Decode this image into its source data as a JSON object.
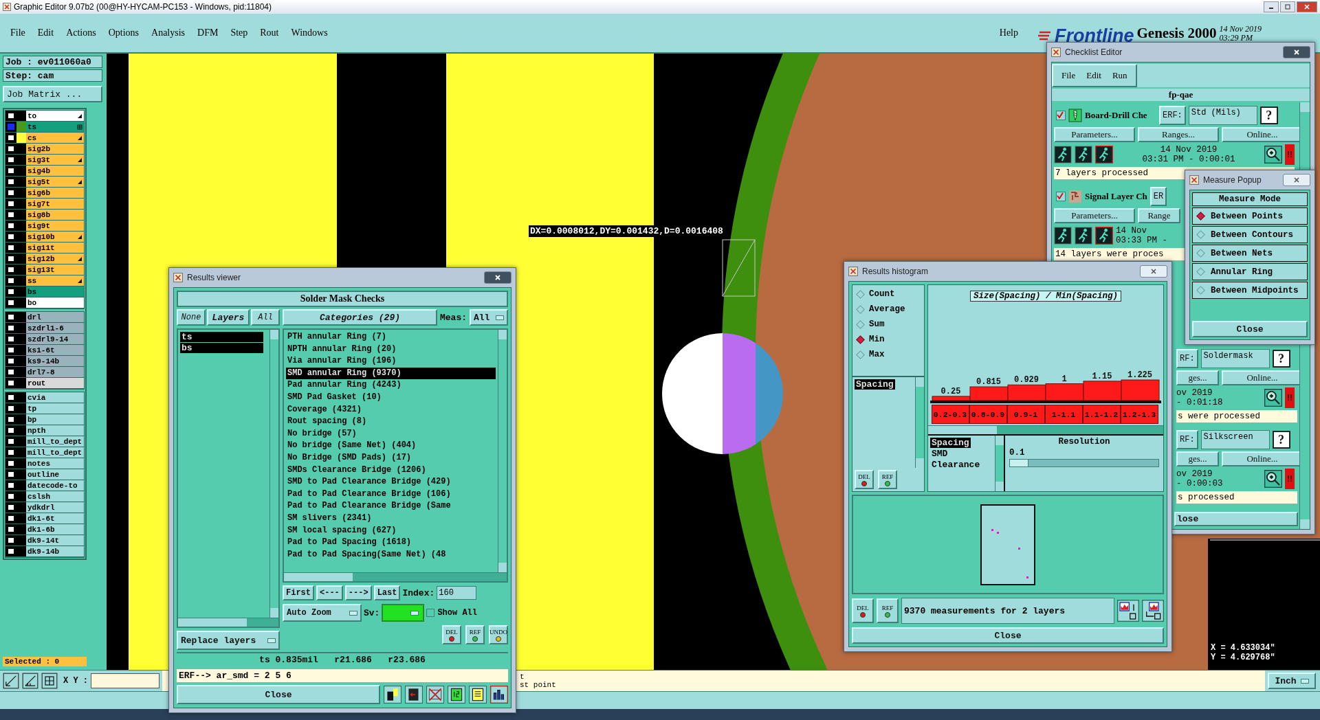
{
  "window": {
    "title": "Graphic Editor 9.07b2 (00@HY-HYCAM-PC153 - Windows, pid:11804)"
  },
  "menu": [
    "File",
    "Edit",
    "Actions",
    "Options",
    "Analysis",
    "DFM",
    "Step",
    "Rout",
    "Windows"
  ],
  "help": "Help",
  "brand": {
    "logo": "Frontline",
    "product": "Genesis 2000",
    "date": "14 Nov 2019",
    "time": "03:29 PM"
  },
  "job": {
    "job": "Job : ev011060a0",
    "step": "Step: cam",
    "matrix_button": "Job Matrix ..."
  },
  "layer_groups": [
    [
      {
        "name": "to",
        "color": "#ffffff",
        "active": false,
        "kind": "marked"
      },
      {
        "name": "ts",
        "color": "#12a07e",
        "swatch": {
          "color": "#4a9a1a"
        },
        "active": true,
        "kind": "grid"
      },
      {
        "name": "cs",
        "color": "#ffc040",
        "swatch": {
          "color": "#ffff40"
        },
        "active": false,
        "kind": "marked"
      },
      {
        "name": "sig2b",
        "color": "#ffc040",
        "active": false
      },
      {
        "name": "sig3t",
        "color": "#ffc040",
        "active": false,
        "kind": "marked"
      },
      {
        "name": "sig4b",
        "color": "#ffc040",
        "active": false
      },
      {
        "name": "sig5t",
        "color": "#ffc040",
        "active": false,
        "kind": "marked"
      },
      {
        "name": "sig6b",
        "color": "#ffc040",
        "active": false
      },
      {
        "name": "sig7t",
        "color": "#ffc040",
        "active": false
      },
      {
        "name": "sig8b",
        "color": "#ffc040",
        "active": false
      },
      {
        "name": "sig9t",
        "color": "#ffc040",
        "active": false
      },
      {
        "name": "sig10b",
        "color": "#ffc040",
        "active": false,
        "kind": "marked"
      },
      {
        "name": "sig11t",
        "color": "#ffc040",
        "active": false
      },
      {
        "name": "sig12b",
        "color": "#ffc040",
        "active": false,
        "kind": "marked"
      },
      {
        "name": "sig13t",
        "color": "#ffc040",
        "active": false
      },
      {
        "name": "ss",
        "color": "#ffc040",
        "active": false,
        "kind": "marked"
      },
      {
        "name": "bs",
        "color": "#12a07e",
        "active": false
      },
      {
        "name": "bo",
        "color": "#ffffff",
        "active": false
      }
    ],
    [
      {
        "name": "drl",
        "color": "#9ab2bc",
        "active": false
      },
      {
        "name": "szdrl1-6",
        "color": "#9ab2bc",
        "active": false
      },
      {
        "name": "szdrl9-14",
        "color": "#9ab2bc",
        "active": false
      },
      {
        "name": "ks1-6t",
        "color": "#9ab2bc",
        "active": false
      },
      {
        "name": "ks9-14b",
        "color": "#9ab2bc",
        "active": false
      },
      {
        "name": "drl7-8",
        "color": "#9ab2bc",
        "active": false
      },
      {
        "name": "rout",
        "color": "#d9d9d9",
        "active": false
      }
    ],
    [
      {
        "name": "cvia",
        "color": "#a0dcdc",
        "active": false
      },
      {
        "name": "tp",
        "color": "#a0dcdc",
        "active": false
      },
      {
        "name": "bp",
        "color": "#a0dcdc",
        "active": false
      },
      {
        "name": "npth",
        "color": "#a0dcdc",
        "active": false
      },
      {
        "name": "mill_to_dept",
        "color": "#a0dcdc",
        "active": false
      },
      {
        "name": "mill_to_dept",
        "color": "#a0dcdc",
        "active": false
      },
      {
        "name": "notes",
        "color": "#a0dcdc",
        "active": false
      },
      {
        "name": "outline",
        "color": "#a0dcdc",
        "active": false
      },
      {
        "name": "datecode-to",
        "color": "#a0dcdc",
        "active": false
      },
      {
        "name": "cslsh",
        "color": "#a0dcdc",
        "active": false
      },
      {
        "name": "ydkdrl",
        "color": "#a0dcdc",
        "active": false
      },
      {
        "name": "dk1-6t",
        "color": "#a0dcdc",
        "active": false
      },
      {
        "name": "dk1-6b",
        "color": "#a0dcdc",
        "active": false
      },
      {
        "name": "dk9-14t",
        "color": "#a0dcdc",
        "active": false
      },
      {
        "name": "dk9-14b",
        "color": "#a0dcdc",
        "active": false
      }
    ]
  ],
  "selected_count": "Selected : 0",
  "canvas": {
    "measurement": "DX=0.0008012,DY=0.001432,D=0.0016408",
    "x": "X = 4.633034\"",
    "y": "Y = 4.629768\""
  },
  "bottom_bar": {
    "xy_label": "X Y :",
    "messages": [
      "t",
      "st point"
    ],
    "units": "Inch"
  },
  "results_viewer": {
    "title": "Results viewer",
    "heading": "Solder Mask Checks",
    "layer_buttons": [
      "None",
      "Layers",
      "All"
    ],
    "layers": [
      {
        "name": "ts",
        "selected": true
      },
      {
        "name": "bs",
        "selected": true
      }
    ],
    "categories_button": "Categories (29)",
    "meas_label": "Meas:",
    "meas_value": "All",
    "categories": [
      {
        "label": "PTH annular Ring (7)",
        "selected": false
      },
      {
        "label": "NPTH annular Ring (20)",
        "selected": false
      },
      {
        "label": "Via annular Ring (196)",
        "selected": false
      },
      {
        "label": "SMD annular Ring (9370)",
        "selected": true
      },
      {
        "label": "Pad annular Ring (4243)",
        "selected": false
      },
      {
        "label": "SMD Pad Gasket (10)",
        "selected": false
      },
      {
        "label": "Coverage (4321)",
        "selected": false
      },
      {
        "label": "Rout spacing (8)",
        "selected": false
      },
      {
        "label": "No bridge (57)",
        "selected": false
      },
      {
        "label": "No bridge (Same Net) (404)",
        "selected": false
      },
      {
        "label": "No Bridge (SMD Pads) (17)",
        "selected": false
      },
      {
        "label": "SMDs Clearance Bridge (1206)",
        "selected": false
      },
      {
        "label": "SMD to Pad Clearance Bridge (429)",
        "selected": false
      },
      {
        "label": "Pad to Pad Clearance Bridge (106)",
        "selected": false
      },
      {
        "label": "Pad to Pad Clearance Bridge (Same",
        "selected": false
      },
      {
        "label": "SM slivers (2341)",
        "selected": false
      },
      {
        "label": "SM local spacing (627)",
        "selected": false
      },
      {
        "label": "Pad to Pad Spacing (1618)",
        "selected": false
      },
      {
        "label": "Pad to Pad Spacing(Same Net) (48",
        "selected": false
      }
    ],
    "nav": [
      "First",
      "<---",
      "--->",
      "Last"
    ],
    "index_label": "Index:",
    "index_value": "160",
    "auto_zoom": "Auto Zoom",
    "sv_label": "Sv:",
    "show_all": {
      "label": "Show All",
      "checked": false
    },
    "tool_buttons": [
      "DEL",
      "REF",
      "UNDO"
    ],
    "replace": "Replace layers",
    "info": "ts 0.835mil   r21.686   r23.686",
    "erf": "ERF--> ar_smd = 2 5 6",
    "close": "Close"
  },
  "histogram": {
    "title": "Results histogram",
    "modes": [
      {
        "label": "Count",
        "selected": false
      },
      {
        "label": "Average",
        "selected": false
      },
      {
        "label": "Sum",
        "selected": false
      },
      {
        "label": "Min",
        "selected": true
      },
      {
        "label": "Max",
        "selected": false
      }
    ],
    "measures": [
      {
        "label": "Spacing",
        "selected": true
      }
    ],
    "tool_buttons": [
      "DEL",
      "REF"
    ],
    "chart_data": {
      "type": "bar",
      "title": "Size(Spacing) / Min(Spacing)",
      "categories": [
        "0.2-0.3",
        "0.8-0.9",
        "0.9-1",
        "1-1.1",
        "1.1-1.2",
        "1.2-1.3"
      ],
      "values": [
        0.25,
        0.815,
        0.929,
        1,
        1.15,
        1.225
      ],
      "data_labels": true
    },
    "types": [
      {
        "label": "Spacing",
        "selected": true
      },
      {
        "label": "SMD",
        "selected": false
      },
      {
        "label": "Clearance",
        "selected": false
      }
    ],
    "resolution": {
      "label": "Resolution",
      "value": "0.1",
      "level": 0.07
    },
    "footer_buttons": [
      "DEL",
      "REF"
    ],
    "summary": "9370 measurements for 2 layers",
    "close": "Close"
  },
  "checklist": {
    "title": "Checklist Editor",
    "menu": [
      "File",
      "Edit",
      "Run"
    ],
    "name": "fp-qae",
    "items": [
      {
        "kind": "full",
        "checked": true,
        "name": "Board-Drill Che",
        "erf_label": "ERF:",
        "erf_value": "Std (Mils)",
        "help": "?",
        "buttons": [
          "Parameters...",
          "Ranges...",
          "Online..."
        ],
        "date": "14 Nov 2019",
        "time": "03:31 PM - 0:00:01",
        "alert": "!!",
        "status": "7 layers processed"
      },
      {
        "kind": "left",
        "checked": true,
        "name": "Signal Layer Ch",
        "erf_label": "ER",
        "buttons": [
          "Parameters...",
          "Range"
        ],
        "date": "14 Nov",
        "time": "03:33 PM -",
        "status": "14 layers were proces"
      },
      {
        "kind": "right",
        "erf_label": "RF:",
        "erf_value": "Soldermask",
        "help": "?",
        "buttons": [
          "ges...",
          "Online..."
        ],
        "date": "ov 2019",
        "time": "- 0:01:18",
        "alert": "!!",
        "status": "s were processed"
      },
      {
        "kind": "right",
        "erf_label": "RF:",
        "erf_value": "Silkscreen",
        "help": "?",
        "buttons": [
          "ges...",
          "Online..."
        ],
        "date": "ov 2019",
        "time": "- 0:00:03",
        "alert": "!!",
        "status": "s processed"
      }
    ],
    "close": "lose"
  },
  "measure_popup": {
    "title": "Measure Popup",
    "heading": "Measure Mode",
    "modes": [
      {
        "label": "Between Points",
        "selected": true
      },
      {
        "label": "Between Contours",
        "selected": false
      },
      {
        "label": "Between Nets",
        "selected": false
      },
      {
        "label": "Annular Ring",
        "selected": false
      },
      {
        "label": "Between Midpoints",
        "selected": false
      }
    ],
    "close": "Close"
  }
}
